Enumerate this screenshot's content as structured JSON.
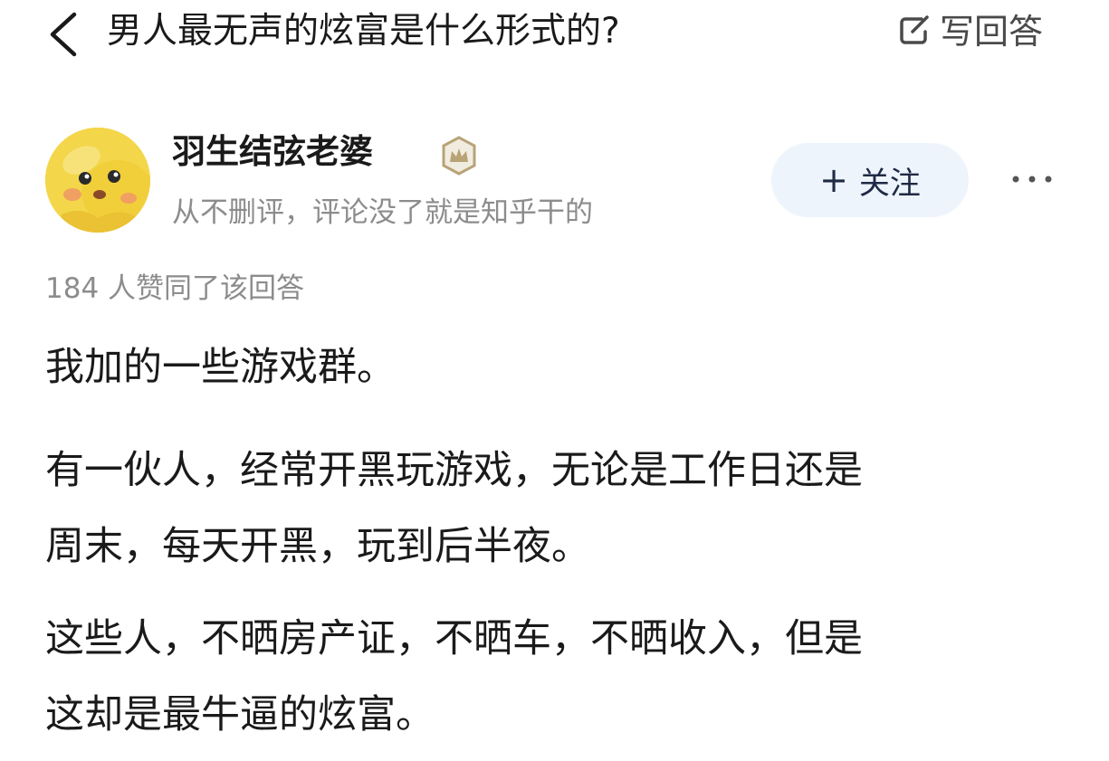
{
  "header": {
    "back_icon": "chevron-left-icon",
    "title": "男人最无声的炫富是什么形式的?",
    "write_answer_icon": "edit-icon",
    "write_answer_label": "写回答"
  },
  "author": {
    "avatar_icon": "avatar",
    "name": "羽生结弦老婆",
    "badge_icon": "badge-icon",
    "bio": "从不删评，评论没了就是知乎干的"
  },
  "follow": {
    "icon": "plus-icon",
    "plus_glyph": "+",
    "label": "关注"
  },
  "more_icon": "more-dots-icon",
  "vote_text": "184 人赞同了该回答",
  "answer": {
    "lines": [
      "我加的一些游戏群。",
      "有一伙人，经常开黑玩游戏，无论是工作日还是",
      "周末，每天开黑，玩到后半夜。",
      "这些人，不晒房产证，不晒车，不晒收入，但是",
      "这却是最牛逼的炫富。"
    ]
  },
  "colors": {
    "text": "#1a1a1a",
    "secondary": "#8c8c8c",
    "follow_bg": "#eef4fc",
    "avatar": "#f3d64a"
  }
}
